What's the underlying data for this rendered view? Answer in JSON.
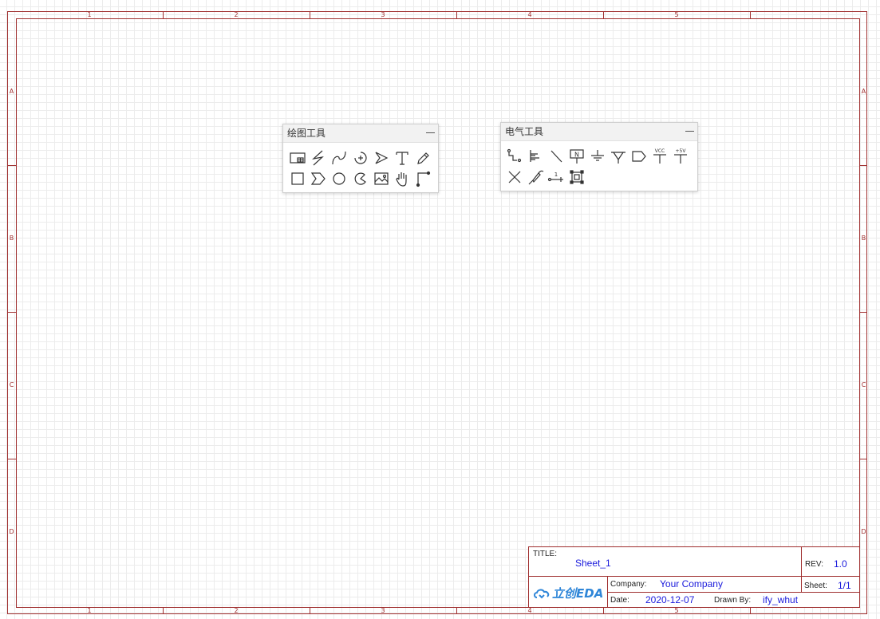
{
  "frame": {
    "columns": [
      "1",
      "2",
      "3",
      "4",
      "5"
    ],
    "rows": [
      "A",
      "B",
      "C",
      "D"
    ]
  },
  "drawing_tools": {
    "title": "绘图工具",
    "tools": [
      {
        "name": "image-frame-icon"
      },
      {
        "name": "wire-bolt-icon"
      },
      {
        "name": "bezier-curve-icon"
      },
      {
        "name": "arc-plus-icon"
      },
      {
        "name": "arrowhead-icon"
      },
      {
        "name": "text-icon"
      },
      {
        "name": "freehand-pencil-icon"
      },
      {
        "name": "rectangle-icon"
      },
      {
        "name": "polygon-chevron-icon"
      },
      {
        "name": "circle-icon"
      },
      {
        "name": "pie-icon"
      },
      {
        "name": "image-icon"
      },
      {
        "name": "drag-hand-icon"
      },
      {
        "name": "canvas-origin-icon"
      }
    ]
  },
  "electrical_tools": {
    "title": "电气工具",
    "tools": [
      {
        "name": "wire-icon"
      },
      {
        "name": "bus-icon"
      },
      {
        "name": "bus-entry-icon"
      },
      {
        "name": "netlabel-icon",
        "text": "N"
      },
      {
        "name": "ground-icon"
      },
      {
        "name": "ground-triangle-icon"
      },
      {
        "name": "netport-icon"
      },
      {
        "name": "vcc-icon",
        "text": "VCC"
      },
      {
        "name": "plus5v-icon",
        "text": "+5V"
      },
      {
        "name": "no-connect-icon"
      },
      {
        "name": "probe-icon"
      },
      {
        "name": "pin-icon",
        "text": "1"
      },
      {
        "name": "group-icon"
      }
    ]
  },
  "title_block": {
    "title_label": "TITLE:",
    "title_value": "Sheet_1",
    "rev_label": "REV:",
    "rev_value": "1.0",
    "company_label": "Company:",
    "company_value": "Your Company",
    "sheet_label": "Sheet:",
    "sheet_value": "1/1",
    "date_label": "Date:",
    "date_value": "2020-12-07",
    "drawn_label": "Drawn By:",
    "drawn_value": "ify_whut",
    "logo_text": "立创EDA"
  },
  "colors": {
    "frame": "#a03030",
    "value_text": "#1a1adc",
    "logo": "#2f86d8"
  }
}
